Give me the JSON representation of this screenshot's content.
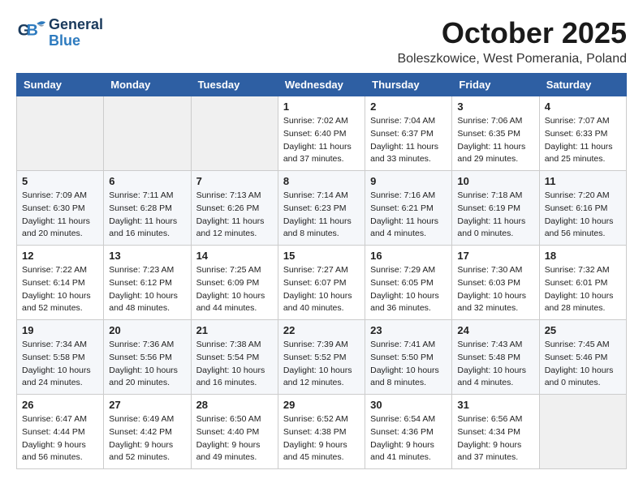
{
  "header": {
    "logo_general": "General",
    "logo_blue": "Blue",
    "month": "October 2025",
    "location": "Boleszkowice, West Pomerania, Poland"
  },
  "weekdays": [
    "Sunday",
    "Monday",
    "Tuesday",
    "Wednesday",
    "Thursday",
    "Friday",
    "Saturday"
  ],
  "weeks": [
    [
      {
        "day": "",
        "info": ""
      },
      {
        "day": "",
        "info": ""
      },
      {
        "day": "",
        "info": ""
      },
      {
        "day": "1",
        "info": "Sunrise: 7:02 AM\nSunset: 6:40 PM\nDaylight: 11 hours\nand 37 minutes."
      },
      {
        "day": "2",
        "info": "Sunrise: 7:04 AM\nSunset: 6:37 PM\nDaylight: 11 hours\nand 33 minutes."
      },
      {
        "day": "3",
        "info": "Sunrise: 7:06 AM\nSunset: 6:35 PM\nDaylight: 11 hours\nand 29 minutes."
      },
      {
        "day": "4",
        "info": "Sunrise: 7:07 AM\nSunset: 6:33 PM\nDaylight: 11 hours\nand 25 minutes."
      }
    ],
    [
      {
        "day": "5",
        "info": "Sunrise: 7:09 AM\nSunset: 6:30 PM\nDaylight: 11 hours\nand 20 minutes."
      },
      {
        "day": "6",
        "info": "Sunrise: 7:11 AM\nSunset: 6:28 PM\nDaylight: 11 hours\nand 16 minutes."
      },
      {
        "day": "7",
        "info": "Sunrise: 7:13 AM\nSunset: 6:26 PM\nDaylight: 11 hours\nand 12 minutes."
      },
      {
        "day": "8",
        "info": "Sunrise: 7:14 AM\nSunset: 6:23 PM\nDaylight: 11 hours\nand 8 minutes."
      },
      {
        "day": "9",
        "info": "Sunrise: 7:16 AM\nSunset: 6:21 PM\nDaylight: 11 hours\nand 4 minutes."
      },
      {
        "day": "10",
        "info": "Sunrise: 7:18 AM\nSunset: 6:19 PM\nDaylight: 11 hours\nand 0 minutes."
      },
      {
        "day": "11",
        "info": "Sunrise: 7:20 AM\nSunset: 6:16 PM\nDaylight: 10 hours\nand 56 minutes."
      }
    ],
    [
      {
        "day": "12",
        "info": "Sunrise: 7:22 AM\nSunset: 6:14 PM\nDaylight: 10 hours\nand 52 minutes."
      },
      {
        "day": "13",
        "info": "Sunrise: 7:23 AM\nSunset: 6:12 PM\nDaylight: 10 hours\nand 48 minutes."
      },
      {
        "day": "14",
        "info": "Sunrise: 7:25 AM\nSunset: 6:09 PM\nDaylight: 10 hours\nand 44 minutes."
      },
      {
        "day": "15",
        "info": "Sunrise: 7:27 AM\nSunset: 6:07 PM\nDaylight: 10 hours\nand 40 minutes."
      },
      {
        "day": "16",
        "info": "Sunrise: 7:29 AM\nSunset: 6:05 PM\nDaylight: 10 hours\nand 36 minutes."
      },
      {
        "day": "17",
        "info": "Sunrise: 7:30 AM\nSunset: 6:03 PM\nDaylight: 10 hours\nand 32 minutes."
      },
      {
        "day": "18",
        "info": "Sunrise: 7:32 AM\nSunset: 6:01 PM\nDaylight: 10 hours\nand 28 minutes."
      }
    ],
    [
      {
        "day": "19",
        "info": "Sunrise: 7:34 AM\nSunset: 5:58 PM\nDaylight: 10 hours\nand 24 minutes."
      },
      {
        "day": "20",
        "info": "Sunrise: 7:36 AM\nSunset: 5:56 PM\nDaylight: 10 hours\nand 20 minutes."
      },
      {
        "day": "21",
        "info": "Sunrise: 7:38 AM\nSunset: 5:54 PM\nDaylight: 10 hours\nand 16 minutes."
      },
      {
        "day": "22",
        "info": "Sunrise: 7:39 AM\nSunset: 5:52 PM\nDaylight: 10 hours\nand 12 minutes."
      },
      {
        "day": "23",
        "info": "Sunrise: 7:41 AM\nSunset: 5:50 PM\nDaylight: 10 hours\nand 8 minutes."
      },
      {
        "day": "24",
        "info": "Sunrise: 7:43 AM\nSunset: 5:48 PM\nDaylight: 10 hours\nand 4 minutes."
      },
      {
        "day": "25",
        "info": "Sunrise: 7:45 AM\nSunset: 5:46 PM\nDaylight: 10 hours\nand 0 minutes."
      }
    ],
    [
      {
        "day": "26",
        "info": "Sunrise: 6:47 AM\nSunset: 4:44 PM\nDaylight: 9 hours\nand 56 minutes."
      },
      {
        "day": "27",
        "info": "Sunrise: 6:49 AM\nSunset: 4:42 PM\nDaylight: 9 hours\nand 52 minutes."
      },
      {
        "day": "28",
        "info": "Sunrise: 6:50 AM\nSunset: 4:40 PM\nDaylight: 9 hours\nand 49 minutes."
      },
      {
        "day": "29",
        "info": "Sunrise: 6:52 AM\nSunset: 4:38 PM\nDaylight: 9 hours\nand 45 minutes."
      },
      {
        "day": "30",
        "info": "Sunrise: 6:54 AM\nSunset: 4:36 PM\nDaylight: 9 hours\nand 41 minutes."
      },
      {
        "day": "31",
        "info": "Sunrise: 6:56 AM\nSunset: 4:34 PM\nDaylight: 9 hours\nand 37 minutes."
      },
      {
        "day": "",
        "info": ""
      }
    ]
  ]
}
